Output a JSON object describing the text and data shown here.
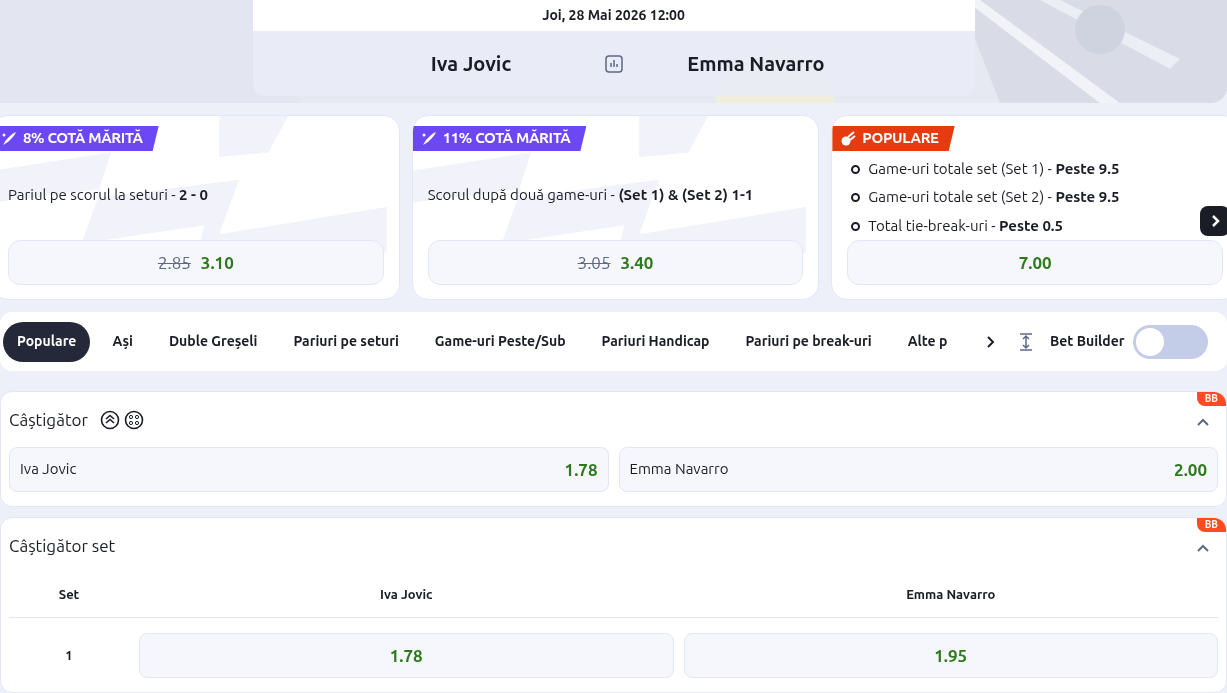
{
  "event": {
    "date": "Joi, 28 Mai 2026 12:00",
    "home": "Iva Jovic",
    "away": "Emma Navarro"
  },
  "promos": [
    {
      "kind": "boost",
      "badge": "8% COTĂ MĂRITĂ",
      "selection": "Pariul pe scorul la seturi - **2 - 0**",
      "old_odds": "2.85",
      "odds": "3.10"
    },
    {
      "kind": "boost",
      "badge": "11% COTĂ MĂRITĂ",
      "selection": "Scorul după două game-uri - **(Set 1) & (Set 2) 1-1**",
      "old_odds": "3.05",
      "odds": "3.40"
    },
    {
      "kind": "popular",
      "badge": "POPULARE",
      "legs": [
        "Game-uri totale set (Set 1) - **Peste 9.5**",
        "Game-uri totale set (Set 2) - **Peste 9.5**",
        "Total tie-break-uri - **Peste 0.5**"
      ],
      "odds": "7.00"
    }
  ],
  "tabs": [
    {
      "label": "Populare",
      "selected": true
    },
    {
      "label": "Ași",
      "selected": false
    },
    {
      "label": "Duble Greșeli",
      "selected": false
    },
    {
      "label": "Pariuri pe seturi",
      "selected": false
    },
    {
      "label": "Game-uri Peste/Sub",
      "selected": false
    },
    {
      "label": "Pariuri Handicap",
      "selected": false
    },
    {
      "label": "Pariuri pe break-uri",
      "selected": false
    },
    {
      "label": "Alte p",
      "selected": false
    }
  ],
  "bet_builder": {
    "label": "Bet Builder",
    "on": false
  },
  "markets": [
    {
      "kind": "two-way",
      "title": "Câștigător",
      "badge": "BB",
      "expanded": true,
      "outcomes": [
        {
          "name": "Iva Jovic",
          "odds": "1.78"
        },
        {
          "name": "Emma Navarro",
          "odds": "2.00"
        }
      ]
    },
    {
      "kind": "table",
      "title": "Câștigător set",
      "badge": "BB",
      "expanded": true,
      "columns": [
        "Set",
        "Iva Jovic",
        "Emma Navarro"
      ],
      "rows": [
        {
          "set": "1",
          "odds": [
            "1.78",
            "1.95"
          ]
        }
      ]
    }
  ]
}
